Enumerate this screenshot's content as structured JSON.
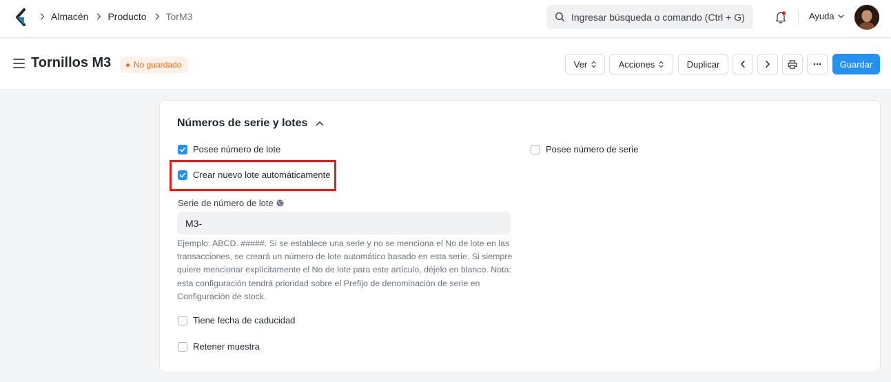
{
  "navbar": {
    "breadcrumbs": [
      {
        "label": "Almacén"
      },
      {
        "label": "Producto"
      },
      {
        "label": "TorM3"
      }
    ],
    "search_placeholder": "Ingresar búsqueda o comando (Ctrl + G)",
    "help_label": "Ayuda"
  },
  "header": {
    "title": "Tornillos M3",
    "status_badge": "No guardado",
    "buttons": {
      "view": "Ver",
      "actions": "Acciones",
      "duplicate": "Duplicar",
      "save": "Guardar"
    }
  },
  "section": {
    "title": "Números de serie y lotes",
    "fields": {
      "has_batch_no": {
        "label": "Posee número de lote",
        "checked": true
      },
      "create_new_batch": {
        "label": "Crear nuevo lote automáticamente",
        "checked": true
      },
      "has_serial_no": {
        "label": "Posee número de serie",
        "checked": false
      },
      "batch_series": {
        "label": "Serie de número de lote",
        "value": "M3-",
        "description": "Ejemplo: ABCD. #####. Si se establece una serie y no se menciona el No de lote en las transacciones, se creará un número de lote automático basado en esta serie. Si siempre quiere mencionar explícitamente el No de lote para este artículo, déjelo en blanco. Nota: esta configuración tendrá prioridad sobre el Prefijo de denominación de serie en Configuración de stock."
      },
      "has_expiry_date": {
        "label": "Tiene fecha de caducidad",
        "checked": false
      },
      "retain_sample": {
        "label": "Retener muestra",
        "checked": false
      }
    }
  },
  "colors": {
    "primary": "#2490ef",
    "highlight_box": "#e0201b",
    "badge_text": "#e86c13",
    "badge_bg": "#fff1e7"
  }
}
